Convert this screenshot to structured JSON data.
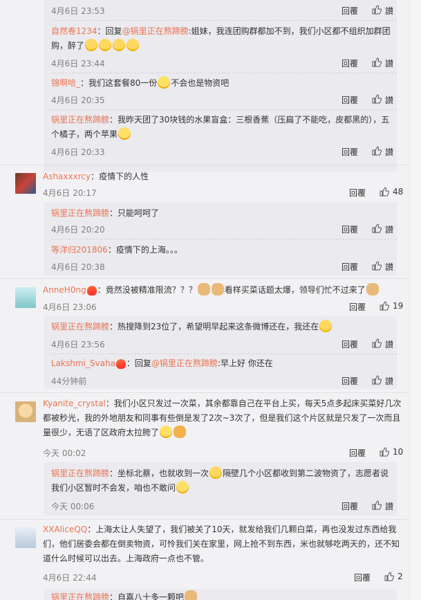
{
  "ui": {
    "reply": "回覆",
    "like": "讃"
  },
  "c1": {
    "time": "4月6日 23:53"
  },
  "c2": {
    "name": "自然卷1234",
    "pre": "：回复",
    "mention": "@锅里正在熬蹄膀",
    "text1": ":姐妹，我连团购群都加不到，我们小区都不组织加群团",
    "text2": "购，醉了",
    "time": "4月6日 23:44"
  },
  "c3": {
    "name": "锦啊哈_",
    "text": "：我们这套餐80一份",
    "text2": "不会也是物资吧",
    "time": "4月6日 20:35"
  },
  "c4": {
    "name": "锅里正在熬蹄膀",
    "text1": "：我昨天团了30块钱的水果盲盒：三根香蕉（压扁了不能吃，皮都黑的），五",
    "text2": "个橘子，两个苹果",
    "time": "4月6日 20:33"
  },
  "c5": {
    "name": "Ashaxxxrcy",
    "text": "：疫情下的人性",
    "time": "4月6日 20:17",
    "likes": "48"
  },
  "c6": {
    "name": "锅里正在熬蹄膀",
    "text": "：只能呵呵了",
    "time": "4月6日 20:20"
  },
  "c7": {
    "name": "等洋归201806",
    "text": "：疫情下的上海。。。",
    "time": "4月6日 20:38"
  },
  "c8": {
    "name": "AnneH0ng",
    "text": "：竟然没被精准限流？？？",
    "text2": "看样买菜话题太爆，领导们忙不过来了",
    "time": "4月6日 23:06",
    "likes": "19"
  },
  "c9": {
    "name": "锅里正在熬蹄膀",
    "text": "：热搜降到23位了，希望明早起来这条微博还在，我还在",
    "time": "4月6日 23:56"
  },
  "c10": {
    "name": "Lakshmi_Svaha",
    "pre": "：回复",
    "mention": "@锅里正在熬蹄膀",
    "text": ":早上好 你还在",
    "time": "44分钟前"
  },
  "c11": {
    "name": "Kyanite_crystal",
    "text1": "：我们小区只发过一次菜，其余都靠自己在平台上买，每天5点多起床买菜好几次",
    "text2": "都被秒光，我的外地朋友和同事有些倒是发了2次~3次了，但是我们这个片区就是只发了一次而且",
    "text3": "量很少，无语了区政府太拉胯了",
    "time": "今天 00:02",
    "likes": "10"
  },
  "c12": {
    "name": "锅里正在熬蹄膀",
    "text1": "：坐标北蔡，也就收到一次",
    "text1b": "隔壁几个小区都收到第二波物资了，志愿者说",
    "text2": "我们小区暂时不会发，咱也不敢问",
    "time": "今天 00:06"
  },
  "c13": {
    "name": "XXAliceQQ",
    "text1": "：上海太让人失望了，我们被关了10天，就发给我们几颗白菜，再也没发过东西给我",
    "text2": "们，他们居委会都在倒卖物资，可怜我们关在家里，网上抢不到东西，米也就够吃两天的，还不知",
    "text3": "道什么时候可以出去。上海政府一点也不管。",
    "time": "4月6日 22:44",
    "likes": "2"
  },
  "c14": {
    "name": "锅里正在熬蹄膀",
    "text": "：自嘉八十多一颗吧"
  }
}
